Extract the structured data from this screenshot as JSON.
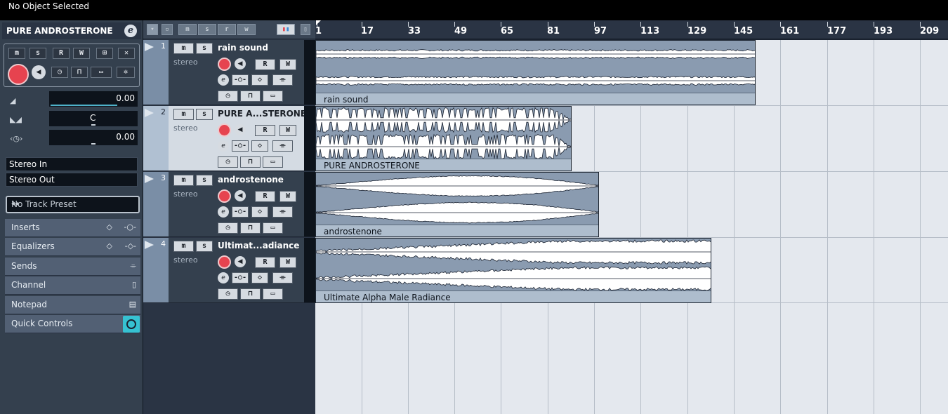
{
  "status": {
    "text": "No Object Selected"
  },
  "inspector": {
    "track_name": "PURE ANDROSTERONE",
    "volume": "0.00",
    "pan": "C",
    "delay": "0.00",
    "input": "Stereo In",
    "output": "Stereo Out",
    "preset": "No Track Preset",
    "sections": [
      "Inserts",
      "Equalizers",
      "Sends",
      "Channel",
      "Notepad",
      "Quick Controls"
    ]
  },
  "buttons": {
    "mute": "m",
    "solo": "s",
    "read": "R",
    "write": "W"
  },
  "tracks": [
    {
      "number": "1",
      "name": "rain sound",
      "type": "stereo",
      "event_label": "rain sound",
      "selected": false
    },
    {
      "number": "2",
      "name": "PURE A...STERONE",
      "type": "stereo",
      "event_label": "PURE ANDROSTERONE",
      "selected": true
    },
    {
      "number": "3",
      "name": "androstenone",
      "type": "stereo",
      "event_label": "androstenone",
      "selected": false
    },
    {
      "number": "4",
      "name": "Ultimat...adiance",
      "type": "stereo",
      "event_label": "Ultimate Alpha Male Radiance",
      "selected": false
    }
  ],
  "ruler": {
    "labels": [
      "1",
      "17",
      "33",
      "49",
      "65",
      "81",
      "97",
      "113",
      "129",
      "145",
      "161",
      "177",
      "193",
      "209"
    ]
  },
  "colors": {
    "event_fill": "#8a9bb0",
    "waveform": "#ffffff",
    "accent": "#36c2d2",
    "record": "#e6434f"
  }
}
